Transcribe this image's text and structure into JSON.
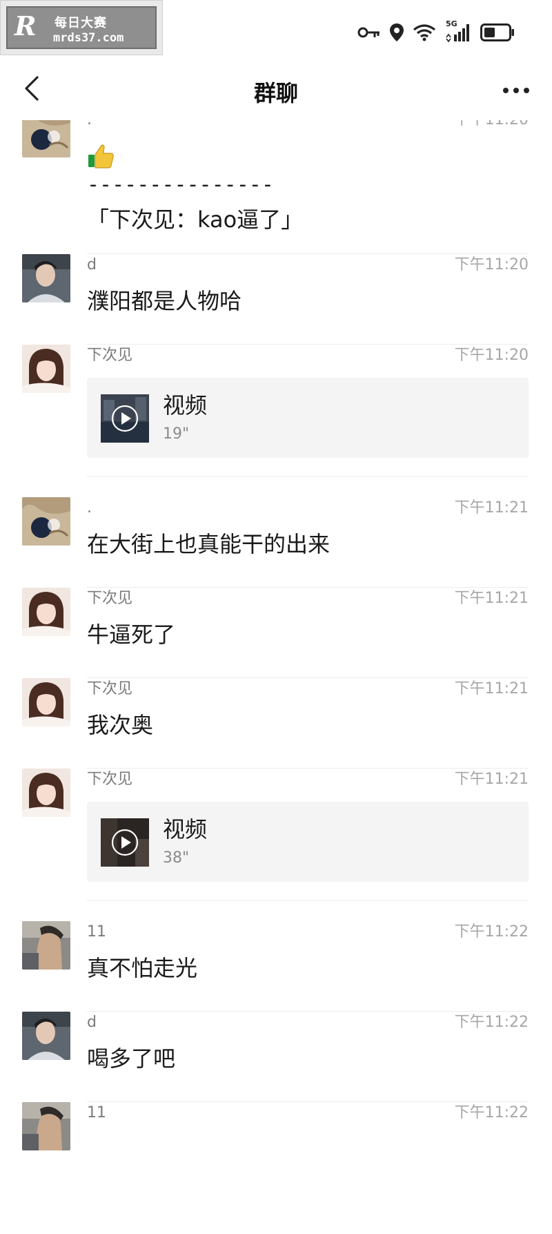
{
  "status_bar": {
    "watermark_logo": "R",
    "watermark_title": "每日大赛",
    "watermark_url": "mrds37.com",
    "network_label": "5G",
    "icons": [
      "key-icon",
      "location-icon",
      "wifi-icon",
      "signal-icon",
      "battery-icon"
    ],
    "battery_level": 0.45
  },
  "nav": {
    "back_icon": "chevron-left-icon",
    "title": "群聊",
    "more_icon": "more-dots-icon"
  },
  "colors": {
    "background": "#ffffff",
    "name_text": "#7a7a7a",
    "time_text": "#a6a6a6",
    "message_text": "#1a1a1a",
    "video_card_bg": "#f4f4f4",
    "divider": "#ececec"
  },
  "messages": [
    {
      "sender": ".",
      "time": "下午11:20",
      "type": "reply",
      "emoji": "thumbs-up-icon",
      "separator": "---------------",
      "text": "「下次见：kao逼了」"
    },
    {
      "sender": "d",
      "time": "下午11:20",
      "type": "text",
      "text": "濮阳都是人物哈"
    },
    {
      "sender": "下次见",
      "time": "下午11:20",
      "type": "video",
      "video_label": "视频",
      "duration": "19\""
    },
    {
      "sender": ".",
      "time": "下午11:21",
      "type": "text",
      "text": "在大街上也真能干的出来"
    },
    {
      "sender": "下次见",
      "time": "下午11:21",
      "type": "text",
      "text": "牛逼死了"
    },
    {
      "sender": "下次见",
      "time": "下午11:21",
      "type": "text",
      "text": "我次奥"
    },
    {
      "sender": "下次见",
      "time": "下午11:21",
      "type": "video",
      "video_label": "视频",
      "duration": "38\""
    },
    {
      "sender": "11",
      "time": "下午11:22",
      "type": "text",
      "text": "真不怕走光"
    },
    {
      "sender": "d",
      "time": "下午11:22",
      "type": "text",
      "text": "喝多了吧"
    },
    {
      "sender": "11",
      "time": "下午11:22",
      "type": "text",
      "text": ""
    }
  ]
}
